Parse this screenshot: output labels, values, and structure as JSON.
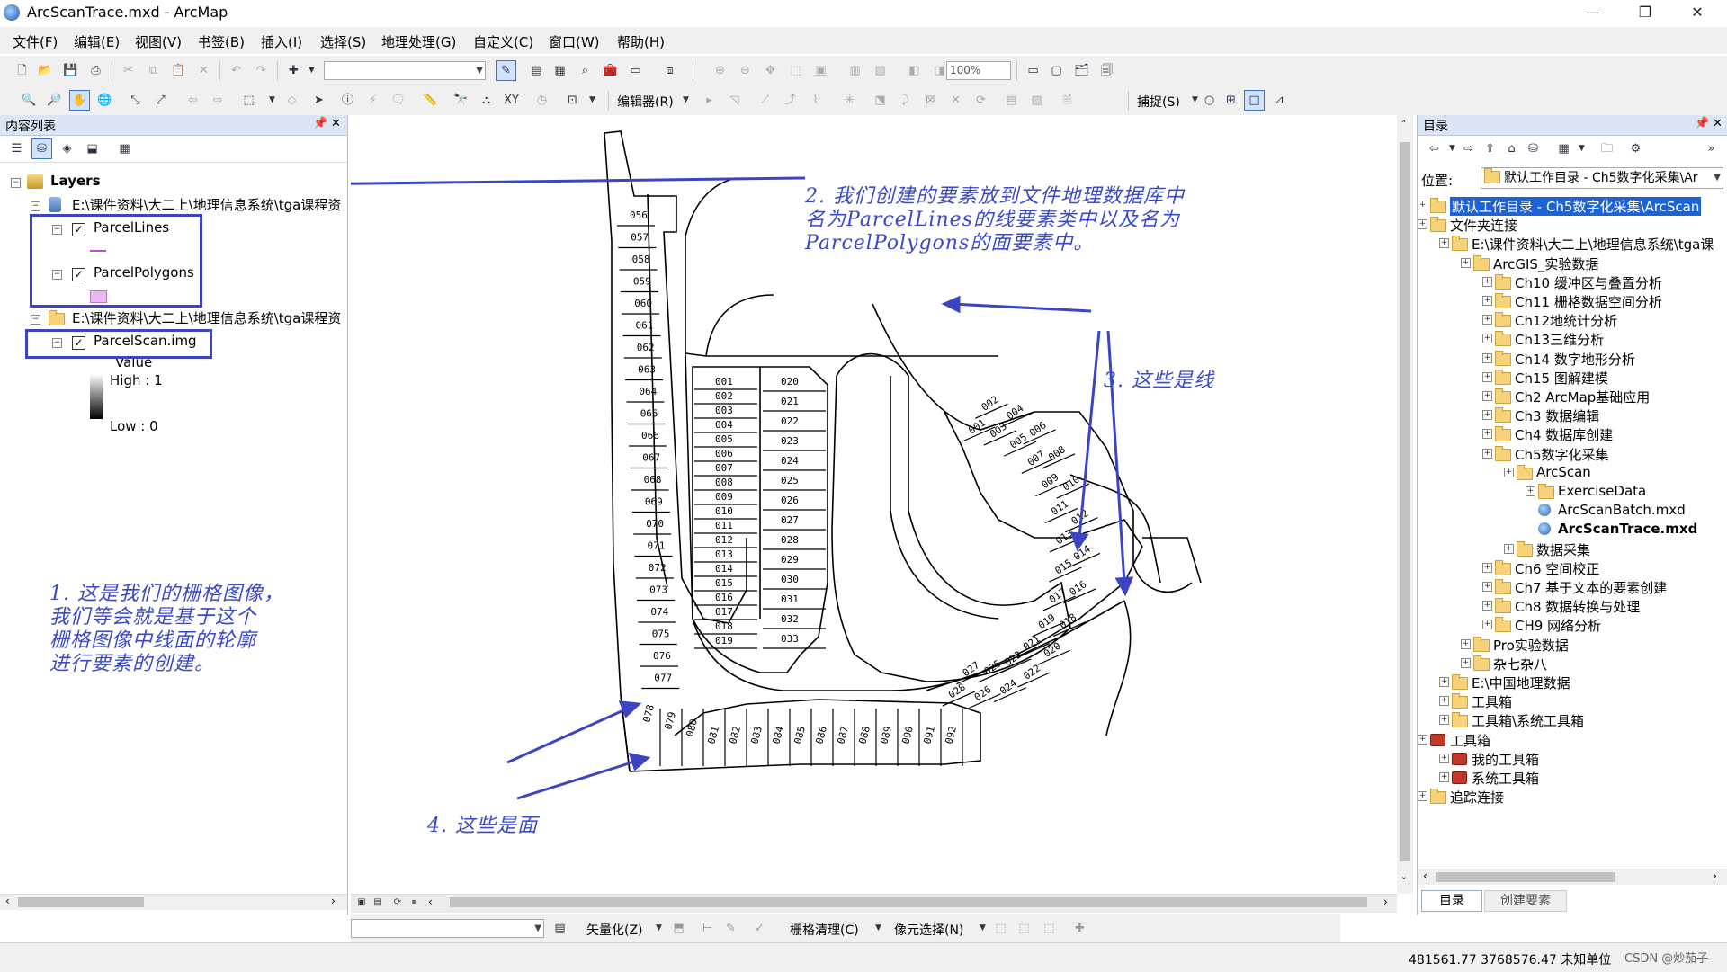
{
  "window": {
    "title": "ArcScanTrace.mxd - ArcMap",
    "minimize": "—",
    "maximize": "❐",
    "close": "✕"
  },
  "menu": [
    "文件(F)",
    "编辑(E)",
    "视图(V)",
    "书签(B)",
    "插入(I)",
    "选择(S)",
    "地理处理(G)",
    "自定义(C)",
    "窗口(W)",
    "帮助(H)"
  ],
  "toolbar": {
    "zoom_value": "100%",
    "editor_label": "编辑器(R)",
    "snap_label": "捕捉(S)",
    "vectorize_label": "矢量化(Z)",
    "raster_cleanup_label": "栅格清理(C)",
    "cell_select_label": "像元选择(N)"
  },
  "toc": {
    "header": "内容列表",
    "layers_label": "Layers",
    "path1": "E:\\课件资料\\大二上\\地理信息系统\\tga课程资",
    "parcel_lines": "ParcelLines",
    "parcel_polygons": "ParcelPolygons",
    "path2": "E:\\课件资料\\大二上\\地理信息系统\\tga课程资",
    "parcel_scan": "ParcelScan.img",
    "value_label": "Value",
    "high_label": "High : 1",
    "low_label": "Low : 0"
  },
  "annotations": {
    "a1": [
      "1. 这是我们的栅格图像，",
      "我们等会就是基于这个",
      "栅格图像中线面的轮廓",
      "进行要素的创建。"
    ],
    "a2": [
      "2. 我们创建的要素放到文件地理数据库中",
      "名为ParcelLines的线要素类中以及名为",
      "ParcelPolygons的面要素中。"
    ],
    "a3": "3. 这些是线",
    "a4": "4. 这些是面"
  },
  "parcels": {
    "left_column": [
      "056",
      "057",
      "058",
      "059",
      "060",
      "061",
      "062",
      "063",
      "064",
      "065",
      "066",
      "067",
      "068",
      "069",
      "070",
      "071",
      "072",
      "073",
      "074",
      "075",
      "076",
      "077"
    ],
    "bottom_row": [
      "078",
      "079",
      "080",
      "081",
      "082",
      "083",
      "084",
      "085",
      "086",
      "087",
      "088",
      "089",
      "090",
      "091",
      "092"
    ],
    "middle_left": [
      "001",
      "002",
      "003",
      "004",
      "005",
      "006",
      "007",
      "008",
      "009",
      "010",
      "011",
      "012",
      "013",
      "014",
      "015",
      "016",
      "017",
      "018",
      "019"
    ],
    "middle_center": [
      "020",
      "021",
      "022",
      "023",
      "024",
      "025",
      "026",
      "027",
      "028",
      "029",
      "030",
      "031",
      "032",
      "033"
    ],
    "middle_right": [
      "001",
      "002",
      "003",
      "004",
      "005",
      "006",
      "007",
      "008",
      "009",
      "010",
      "011",
      "012",
      "013",
      "014",
      "015",
      "016",
      "017",
      "018",
      "019",
      "020",
      "021",
      "022",
      "023",
      "024",
      "025",
      "026",
      "027",
      "028"
    ]
  },
  "catalog": {
    "header": "目录",
    "location_label": "位置:",
    "location_value": "默认工作目录 - Ch5数字化采集\\Ar",
    "items": [
      {
        "label": "默认工作目录 - Ch5数字化采集\\ArcScan",
        "level": 0,
        "selected": true
      },
      {
        "label": "文件夹连接",
        "level": 0
      },
      {
        "label": "E:\\课件资料\\大二上\\地理信息系统\\tga课",
        "level": 1
      },
      {
        "label": "ArcGIS_实验数据",
        "level": 2
      },
      {
        "label": "Ch10 缓冲区与叠置分析",
        "level": 3
      },
      {
        "label": "Ch11 栅格数据空间分析",
        "level": 3
      },
      {
        "label": "Ch12地统计分析",
        "level": 3
      },
      {
        "label": "Ch13三维分析",
        "level": 3
      },
      {
        "label": "Ch14 数字地形分析",
        "level": 3
      },
      {
        "label": "Ch15 图解建模",
        "level": 3
      },
      {
        "label": "Ch2  ArcMap基础应用",
        "level": 3
      },
      {
        "label": "Ch3 数据编辑",
        "level": 3
      },
      {
        "label": "Ch4 数据库创建",
        "level": 3
      },
      {
        "label": "Ch5数字化采集",
        "level": 3
      },
      {
        "label": "ArcScan",
        "level": 4
      },
      {
        "label": "ExerciseData",
        "level": 5
      },
      {
        "label": "ArcScanBatch.mxd",
        "level": 5,
        "mxd": true
      },
      {
        "label": "ArcScanTrace.mxd",
        "level": 5,
        "mxd": true,
        "bold": true
      },
      {
        "label": "数据采集",
        "level": 4
      },
      {
        "label": "Ch6 空间校正",
        "level": 3
      },
      {
        "label": "Ch7 基于文本的要素创建",
        "level": 3
      },
      {
        "label": "Ch8 数据转换与处理",
        "level": 3
      },
      {
        "label": "CH9 网络分析",
        "level": 3
      },
      {
        "label": "Pro实验数据",
        "level": 2
      },
      {
        "label": "杂七杂八",
        "level": 2
      },
      {
        "label": "E:\\中国地理数据",
        "level": 1
      },
      {
        "label": "工具箱",
        "level": 1
      },
      {
        "label": "工具箱\\系统工具箱",
        "level": 1
      },
      {
        "label": "工具箱",
        "level": 0,
        "toolbox": true
      },
      {
        "label": "我的工具箱",
        "level": 1,
        "toolbox": true
      },
      {
        "label": "系统工具箱",
        "level": 1,
        "toolbox": true
      },
      {
        "label": "追踪连接",
        "level": 0
      }
    ],
    "tab_catalog": "目录",
    "tab_create": "创建要素"
  },
  "status": {
    "coords": "481561.77  3768576.47 未知单位",
    "watermark": "CSDN @炒茄子"
  }
}
